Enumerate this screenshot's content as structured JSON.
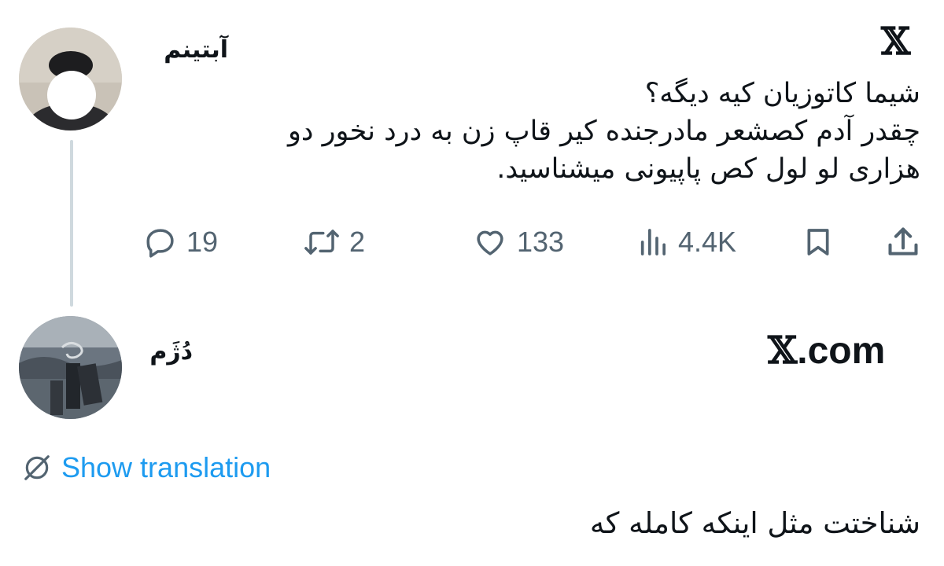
{
  "tweet": {
    "author_name": "آبتینم",
    "logo": "𝕏",
    "text_lines": [
      "شیما کاتوزیان کیه دیگه؟",
      "چقدر آدم کصشعر مادرجنده کیر قاپ زن به درد نخور دو",
      "هزاری  لو لول کص پاپیونی میشناسید."
    ],
    "actions": {
      "replies": "19",
      "reposts": "2",
      "likes": "133",
      "views": "4.4K"
    },
    "icons": [
      "reply-icon",
      "repost-icon",
      "like-icon",
      "views-icon",
      "bookmark-icon",
      "share-icon"
    ]
  },
  "reply": {
    "author_name": "دُژَم",
    "site_logo": "𝕏",
    "site_text": ".com",
    "translate_label": "Show translation",
    "text": "شناختت مثل اینکه کامله که"
  },
  "colors": {
    "text": "#0f1419",
    "muted": "#536471",
    "link": "#1d9bf0",
    "thread_line": "#cfd9de"
  }
}
